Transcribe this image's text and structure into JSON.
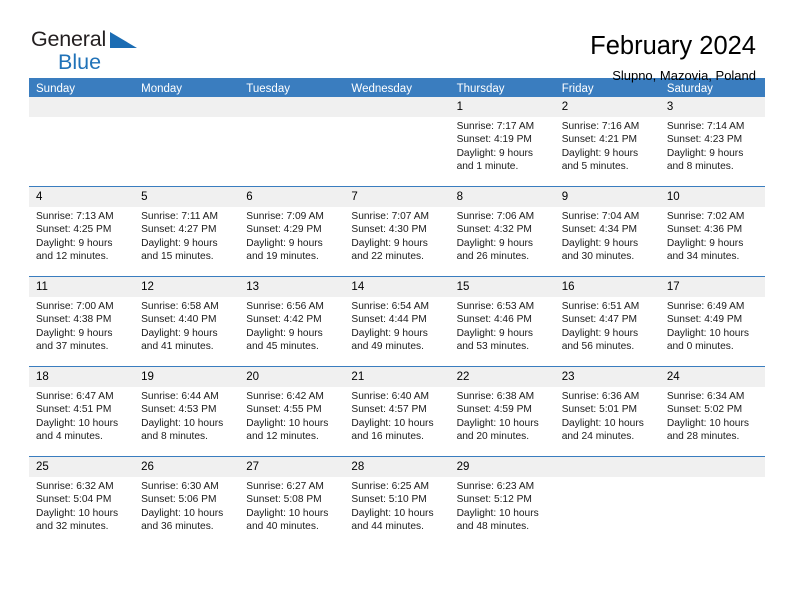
{
  "brand": {
    "name_part1": "General",
    "name_part2": "Blue",
    "flag_color": "#1b6cb3",
    "blue_color": "#2072b8"
  },
  "header": {
    "month_title": "February 2024",
    "location": "Slupno, Mazovia, Poland"
  },
  "theme": {
    "header_row_bg": "#3a7dbf",
    "day_number_bg": "#f0f0f0",
    "separator_color": "#3a7dbf"
  },
  "weekday_headers": [
    "Sunday",
    "Monday",
    "Tuesday",
    "Wednesday",
    "Thursday",
    "Friday",
    "Saturday"
  ],
  "weeks": [
    [
      {
        "day": "",
        "empty": true
      },
      {
        "day": "",
        "empty": true
      },
      {
        "day": "",
        "empty": true
      },
      {
        "day": "",
        "empty": true
      },
      {
        "day": "1",
        "sunrise": "Sunrise: 7:17 AM",
        "sunset": "Sunset: 4:19 PM",
        "daylight1": "Daylight: 9 hours",
        "daylight2": "and 1 minute."
      },
      {
        "day": "2",
        "sunrise": "Sunrise: 7:16 AM",
        "sunset": "Sunset: 4:21 PM",
        "daylight1": "Daylight: 9 hours",
        "daylight2": "and 5 minutes."
      },
      {
        "day": "3",
        "sunrise": "Sunrise: 7:14 AM",
        "sunset": "Sunset: 4:23 PM",
        "daylight1": "Daylight: 9 hours",
        "daylight2": "and 8 minutes."
      }
    ],
    [
      {
        "day": "4",
        "sunrise": "Sunrise: 7:13 AM",
        "sunset": "Sunset: 4:25 PM",
        "daylight1": "Daylight: 9 hours",
        "daylight2": "and 12 minutes."
      },
      {
        "day": "5",
        "sunrise": "Sunrise: 7:11 AM",
        "sunset": "Sunset: 4:27 PM",
        "daylight1": "Daylight: 9 hours",
        "daylight2": "and 15 minutes."
      },
      {
        "day": "6",
        "sunrise": "Sunrise: 7:09 AM",
        "sunset": "Sunset: 4:29 PM",
        "daylight1": "Daylight: 9 hours",
        "daylight2": "and 19 minutes."
      },
      {
        "day": "7",
        "sunrise": "Sunrise: 7:07 AM",
        "sunset": "Sunset: 4:30 PM",
        "daylight1": "Daylight: 9 hours",
        "daylight2": "and 22 minutes."
      },
      {
        "day": "8",
        "sunrise": "Sunrise: 7:06 AM",
        "sunset": "Sunset: 4:32 PM",
        "daylight1": "Daylight: 9 hours",
        "daylight2": "and 26 minutes."
      },
      {
        "day": "9",
        "sunrise": "Sunrise: 7:04 AM",
        "sunset": "Sunset: 4:34 PM",
        "daylight1": "Daylight: 9 hours",
        "daylight2": "and 30 minutes."
      },
      {
        "day": "10",
        "sunrise": "Sunrise: 7:02 AM",
        "sunset": "Sunset: 4:36 PM",
        "daylight1": "Daylight: 9 hours",
        "daylight2": "and 34 minutes."
      }
    ],
    [
      {
        "day": "11",
        "sunrise": "Sunrise: 7:00 AM",
        "sunset": "Sunset: 4:38 PM",
        "daylight1": "Daylight: 9 hours",
        "daylight2": "and 37 minutes."
      },
      {
        "day": "12",
        "sunrise": "Sunrise: 6:58 AM",
        "sunset": "Sunset: 4:40 PM",
        "daylight1": "Daylight: 9 hours",
        "daylight2": "and 41 minutes."
      },
      {
        "day": "13",
        "sunrise": "Sunrise: 6:56 AM",
        "sunset": "Sunset: 4:42 PM",
        "daylight1": "Daylight: 9 hours",
        "daylight2": "and 45 minutes."
      },
      {
        "day": "14",
        "sunrise": "Sunrise: 6:54 AM",
        "sunset": "Sunset: 4:44 PM",
        "daylight1": "Daylight: 9 hours",
        "daylight2": "and 49 minutes."
      },
      {
        "day": "15",
        "sunrise": "Sunrise: 6:53 AM",
        "sunset": "Sunset: 4:46 PM",
        "daylight1": "Daylight: 9 hours",
        "daylight2": "and 53 minutes."
      },
      {
        "day": "16",
        "sunrise": "Sunrise: 6:51 AM",
        "sunset": "Sunset: 4:47 PM",
        "daylight1": "Daylight: 9 hours",
        "daylight2": "and 56 minutes."
      },
      {
        "day": "17",
        "sunrise": "Sunrise: 6:49 AM",
        "sunset": "Sunset: 4:49 PM",
        "daylight1": "Daylight: 10 hours",
        "daylight2": "and 0 minutes."
      }
    ],
    [
      {
        "day": "18",
        "sunrise": "Sunrise: 6:47 AM",
        "sunset": "Sunset: 4:51 PM",
        "daylight1": "Daylight: 10 hours",
        "daylight2": "and 4 minutes."
      },
      {
        "day": "19",
        "sunrise": "Sunrise: 6:44 AM",
        "sunset": "Sunset: 4:53 PM",
        "daylight1": "Daylight: 10 hours",
        "daylight2": "and 8 minutes."
      },
      {
        "day": "20",
        "sunrise": "Sunrise: 6:42 AM",
        "sunset": "Sunset: 4:55 PM",
        "daylight1": "Daylight: 10 hours",
        "daylight2": "and 12 minutes."
      },
      {
        "day": "21",
        "sunrise": "Sunrise: 6:40 AM",
        "sunset": "Sunset: 4:57 PM",
        "daylight1": "Daylight: 10 hours",
        "daylight2": "and 16 minutes."
      },
      {
        "day": "22",
        "sunrise": "Sunrise: 6:38 AM",
        "sunset": "Sunset: 4:59 PM",
        "daylight1": "Daylight: 10 hours",
        "daylight2": "and 20 minutes."
      },
      {
        "day": "23",
        "sunrise": "Sunrise: 6:36 AM",
        "sunset": "Sunset: 5:01 PM",
        "daylight1": "Daylight: 10 hours",
        "daylight2": "and 24 minutes."
      },
      {
        "day": "24",
        "sunrise": "Sunrise: 6:34 AM",
        "sunset": "Sunset: 5:02 PM",
        "daylight1": "Daylight: 10 hours",
        "daylight2": "and 28 minutes."
      }
    ],
    [
      {
        "day": "25",
        "sunrise": "Sunrise: 6:32 AM",
        "sunset": "Sunset: 5:04 PM",
        "daylight1": "Daylight: 10 hours",
        "daylight2": "and 32 minutes."
      },
      {
        "day": "26",
        "sunrise": "Sunrise: 6:30 AM",
        "sunset": "Sunset: 5:06 PM",
        "daylight1": "Daylight: 10 hours",
        "daylight2": "and 36 minutes."
      },
      {
        "day": "27",
        "sunrise": "Sunrise: 6:27 AM",
        "sunset": "Sunset: 5:08 PM",
        "daylight1": "Daylight: 10 hours",
        "daylight2": "and 40 minutes."
      },
      {
        "day": "28",
        "sunrise": "Sunrise: 6:25 AM",
        "sunset": "Sunset: 5:10 PM",
        "daylight1": "Daylight: 10 hours",
        "daylight2": "and 44 minutes."
      },
      {
        "day": "29",
        "sunrise": "Sunrise: 6:23 AM",
        "sunset": "Sunset: 5:12 PM",
        "daylight1": "Daylight: 10 hours",
        "daylight2": "and 48 minutes."
      },
      {
        "day": "",
        "empty": true
      },
      {
        "day": "",
        "empty": true
      }
    ]
  ]
}
